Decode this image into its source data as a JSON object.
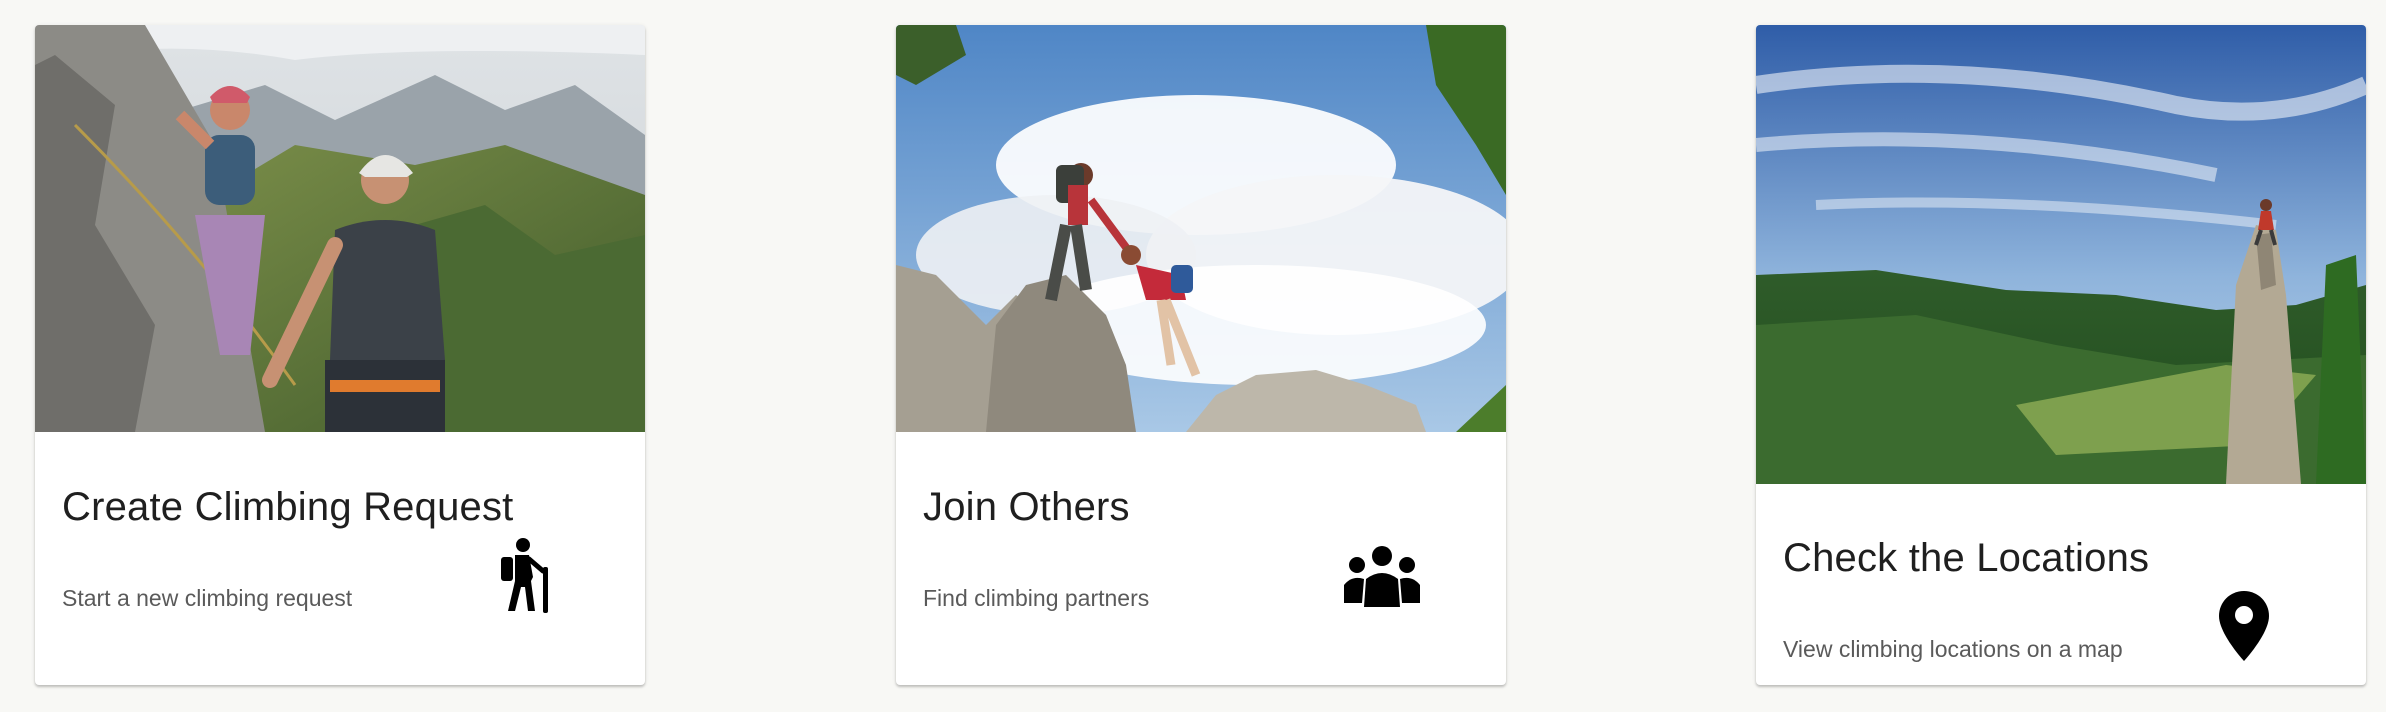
{
  "cards": [
    {
      "title": "Create Climbing Request",
      "subtitle": "Start a new climbing request",
      "image": "climbers-on-rock-wall-photo",
      "icon": "hiker-icon"
    },
    {
      "title": "Join Others",
      "subtitle": "Find climbing partners",
      "image": "climber-helping-partner-photo",
      "icon": "group-icon"
    },
    {
      "title": "Check the Locations",
      "subtitle": "View climbing locations on a map",
      "image": "climber-on-rock-pillar-valley-photo",
      "icon": "map-pin-icon"
    }
  ],
  "colors": {
    "page_background": "#f8f8f5",
    "card_background": "#ffffff",
    "title_text": "#1f1f1f",
    "subtitle_text": "#5a5a5a",
    "icon": "#000000"
  }
}
